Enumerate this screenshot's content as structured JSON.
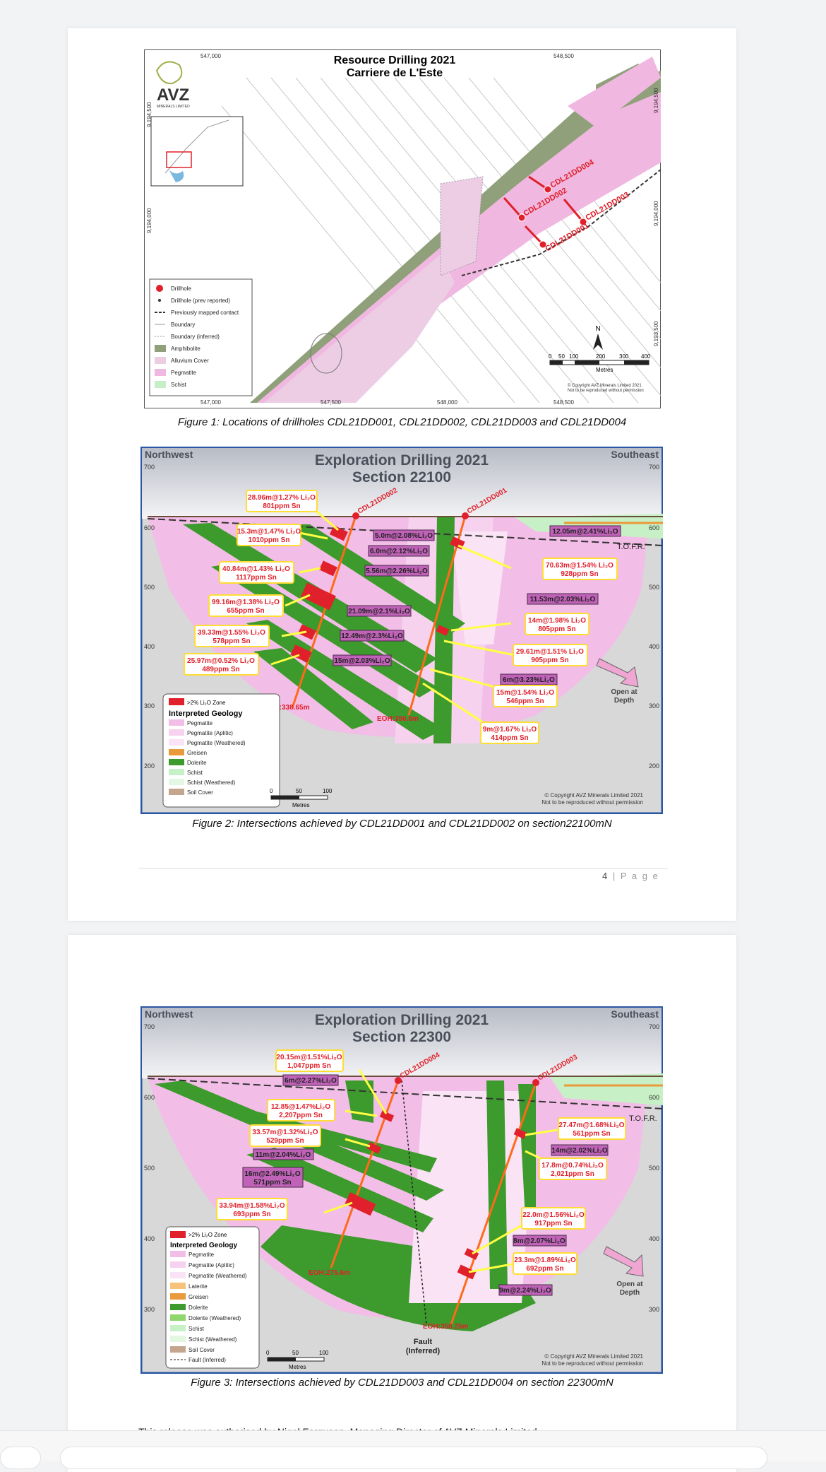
{
  "fig1": {
    "title1": "Resource Drilling 2021",
    "title2": "Carriere de L'Este",
    "logo": "AVZ",
    "logo_sub": "MINERALS LIMITED",
    "coords_top": [
      "547,000",
      "548,500"
    ],
    "coords_bottom": [
      "547,000",
      "547,500",
      "548,000",
      "548,500"
    ],
    "coords_left": [
      "9,194,500",
      "9,194,000"
    ],
    "coords_right": [
      "9,194,500",
      "9,194,000",
      "9,193,500"
    ],
    "holes": [
      "CDL21DD004",
      "CDL21DD002",
      "CDL21DD003",
      "CDL21DD001"
    ],
    "legend": [
      "Drillhole",
      "Drillhole (prev reported)",
      "Previously mapped contact",
      "Boundary",
      "Boundary (inferred)",
      "Amphibolite",
      "Alluvium Cover",
      "Pegmatite",
      "Schist"
    ],
    "scale_labels": [
      "0",
      "50",
      "100",
      "200",
      "300",
      "400"
    ],
    "scale_unit": "Metres",
    "north": "N",
    "copyright": [
      "© Copyright AVZ Minerals Limited 2021",
      "Not to be reproduced without permission"
    ],
    "caption": "Figure 1: Locations of drillholes CDL21DD001, CDL21DD002, CDL21DD003 and CDL21DD004"
  },
  "fig2": {
    "title1": "Exploration Drilling 2021",
    "title2": "Section 22100",
    "nw": "Northwest",
    "se": "Southeast",
    "elev": [
      "700",
      "600",
      "500",
      "400",
      "300",
      "200"
    ],
    "holes": [
      "CDL21DD002",
      "CDL21DD001"
    ],
    "eoh": [
      "EOH:338.65m",
      "EOH:356.6m"
    ],
    "left_labels": [
      [
        "28.96m@1.27% Li₂O",
        "801ppm Sn"
      ],
      [
        "15.3m@1.47% Li₂O",
        "1010ppm Sn"
      ],
      [
        "40.84m@1.43% Li₂O",
        "1117ppm Sn"
      ],
      [
        "99.16m@1.38% Li₂O",
        "655ppm Sn"
      ],
      [
        "39.33m@1.55% Li₂O",
        "578ppm Sn"
      ],
      [
        "25.97m@0.52% Li₂O",
        "489ppm Sn"
      ]
    ],
    "mid_labels": [
      "5.0m@2.08%Li₂O",
      "6.0m@2.12%Li₂O",
      "5.56m@2.26%Li₂O",
      "21.09m@2.1%Li₂O",
      "12.49m@2.3%Li₂O",
      "15m@2.03%Li₂O"
    ],
    "right_purple": [
      "12.05m@2.41%Li₂O",
      "11.53m@2.03%Li₂O",
      "6m@3.23%Li₂O"
    ],
    "right_labels": [
      [
        "70.63m@1.54% Li₂O",
        "928ppm Sn"
      ],
      [
        "14m@1.98% Li₂O",
        "805ppm Sn"
      ],
      [
        "29.61m@1.51% Li₂O",
        "905ppm Sn"
      ],
      [
        "15m@1.54% Li₂O",
        "546ppm Sn"
      ],
      [
        "9m@1.67% Li₂O",
        "414ppm Sn"
      ]
    ],
    "tofr": "T.O.F.R.",
    "open_depth": [
      "Open at",
      "Depth"
    ],
    "legend_zone": ">2% Li₂O Zone",
    "legend_title": "Interpreted Geology",
    "legend": [
      "Pegmatite",
      "Pegmatite (Aplitic)",
      "Pegmatite (Weathered)",
      "Greisen",
      "Dolerite",
      "Schist",
      "Schist (Weathered)",
      "Soil Cover"
    ],
    "scale": [
      "0",
      "50",
      "100"
    ],
    "scale_unit": "Metres",
    "copyright": [
      "© Copyright AVZ Minerals Limited 2021",
      "Not to be reproduced without permission"
    ],
    "caption": "Figure 2: Intersections achieved by CDL21DD001 and CDL21DD002 on section22100mN"
  },
  "page1_num": "4",
  "page_word": "P a g e",
  "fig3": {
    "title1": "Exploration Drilling 2021",
    "title2": "Section 22300",
    "nw": "Northwest",
    "se": "Southeast",
    "elev": [
      "700",
      "600",
      "500",
      "400",
      "300"
    ],
    "holes": [
      "CDL21DD004",
      "CDL21DD003"
    ],
    "eoh": [
      "EOH:275.6m",
      "EOH:350.25m"
    ],
    "left_labels": [
      [
        "20.15m@1.51%Li₂O",
        "1,047ppm Sn"
      ],
      [
        "12.85@1.47%Li₂O",
        "2,207ppm Sn"
      ],
      [
        "33.57m@1.32%Li₂O",
        "529ppm Sn"
      ],
      [
        "33.94m@1.58%Li₂O",
        "693ppm Sn"
      ]
    ],
    "left_purple": [
      "6m@2.27%Li₂O",
      "11m@2.04%Li₂O"
    ],
    "left_purple2": [
      "16m@2.49%Li₂O",
      "571ppm Sn"
    ],
    "right_labels": [
      [
        "27.47m@1.68%Li₂O",
        "561ppm Sn"
      ],
      [
        "17.8m@0.74%Li₂O",
        "2,021ppm Sn"
      ],
      [
        "22.0m@1.56%Li₂O",
        "917ppm Sn"
      ],
      [
        "23.3m@1.89%Li₂O",
        "692ppm Sn"
      ]
    ],
    "right_purple": [
      "14m@2.02%Li₂O",
      "8m@2.07%Li₂O",
      "9m@2.24%Li₂O"
    ],
    "tofr": "T.O.F.R.",
    "open_depth": [
      "Open at",
      "Depth"
    ],
    "fault": [
      "Fault",
      "(Inferred)"
    ],
    "legend_zone": ">2% Li₂O Zone",
    "legend_title": "Interpreted Geology",
    "legend": [
      "Pegmatite",
      "Pegmatite (Aplitic)",
      "Pegmatite (Weathered)",
      "Laterite",
      "Greisen",
      "Dolerite",
      "Dolerite (Weathered)",
      "Schist",
      "Schist (Weathered)",
      "Soil Cover",
      "Fault (Inferred)"
    ],
    "scale": [
      "0",
      "50",
      "100"
    ],
    "scale_unit": "Metres",
    "copyright": [
      "© Copyright AVZ Minerals Limited 2021",
      "Not to be reproduced without permission"
    ],
    "caption": "Figure 3: Intersections achieved by CDL21DD003 and CDL21DD004 on section 22300mN"
  },
  "release_text": "This release was authorised by Nigel Ferguson, Managing Director of AVZ Minerals Limited."
}
